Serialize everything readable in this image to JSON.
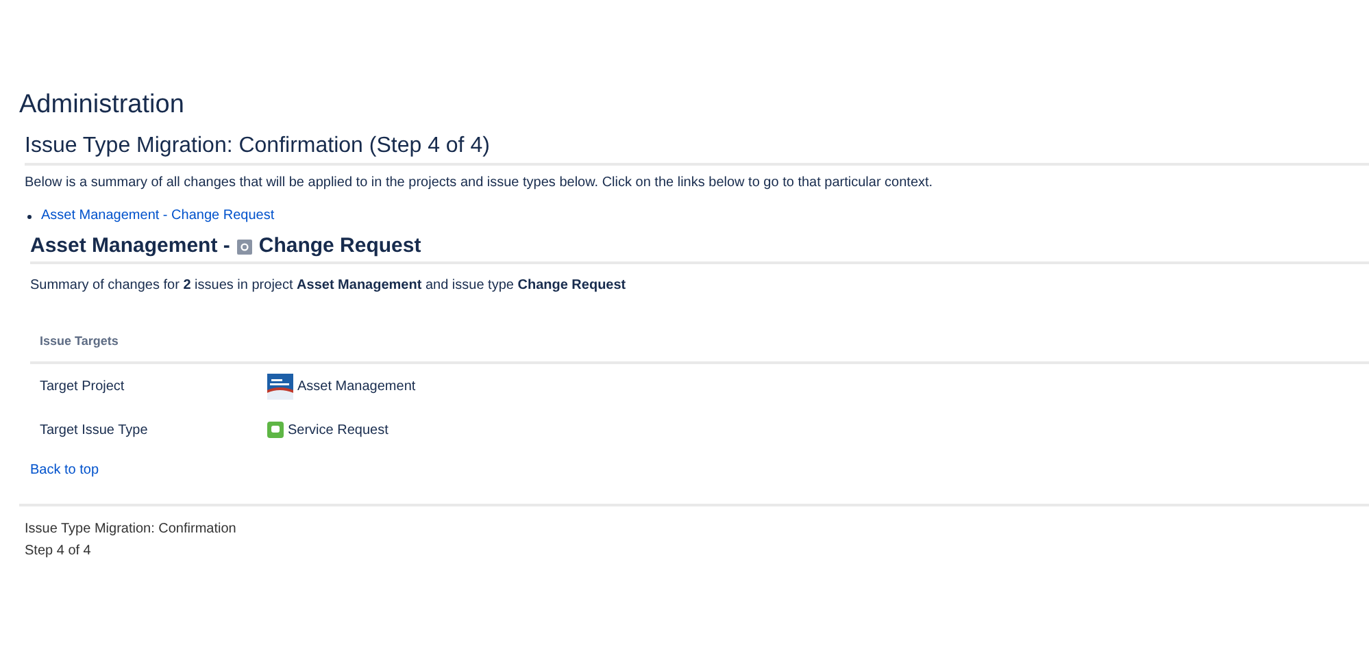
{
  "page_title": "Administration",
  "section_title": "Issue Type Migration: Confirmation (Step 4 of 4)",
  "intro": "Below is a summary of all changes that will be applied to in the projects and issue types below. Click on the links below to go to that particular context.",
  "context_links": [
    "Asset Management - Change Request"
  ],
  "context": {
    "project": "Asset Management -",
    "issue_type": "Change Request",
    "summary": "Summary of changes for **2** issues in project **Asset Management** and issue type **Change Request**",
    "table_heading": "Issue Targets",
    "rows": [
      {
        "kind": "project",
        "label": "Target Project",
        "value": "Asset Management"
      },
      {
        "kind": "issue_type",
        "label": "Target Issue Type",
        "value": "Service Request"
      }
    ],
    "back_link": "Back to top"
  },
  "footer": {
    "title": "Issue Type Migration: Confirmation",
    "step": "Step 4 of 4"
  }
}
